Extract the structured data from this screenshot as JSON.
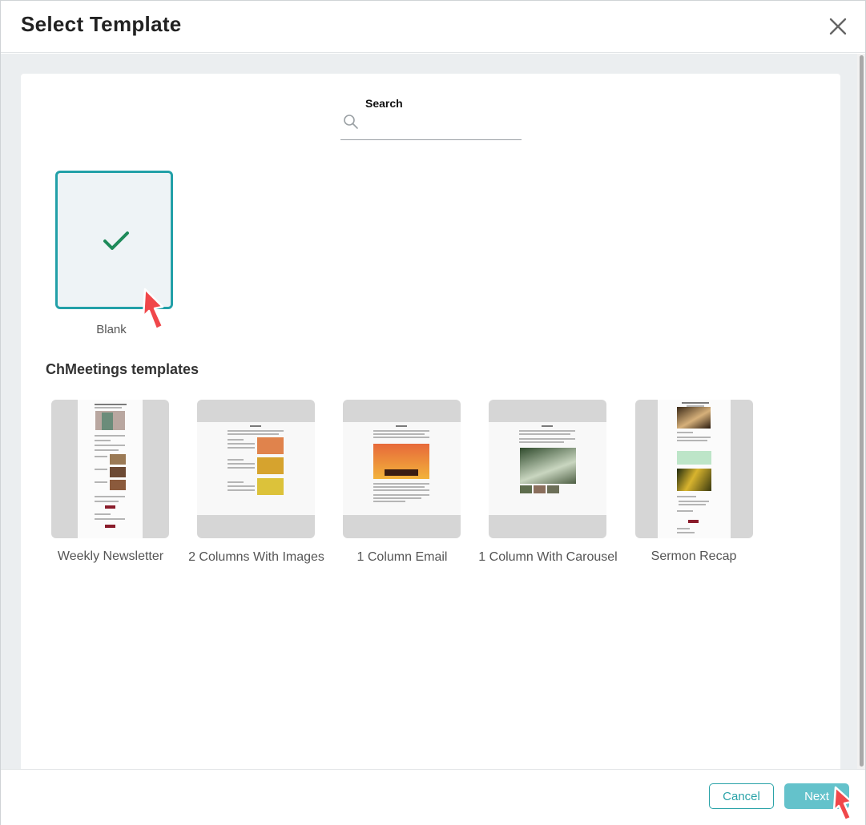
{
  "dialog": {
    "title": "Select Template"
  },
  "search": {
    "label": "Search",
    "value": "",
    "placeholder": ""
  },
  "blank": {
    "label": "Blank",
    "selected": true,
    "accent": "#22a0a8",
    "check_color": "#1e8a5a"
  },
  "section": {
    "title": "ChMeetings templates"
  },
  "templates": [
    {
      "label": "Weekly Newsletter"
    },
    {
      "label": "2 Columns With Images"
    },
    {
      "label": "1 Column Email"
    },
    {
      "label": "1 Column With Carousel"
    },
    {
      "label": "Sermon Recap"
    }
  ],
  "footer": {
    "cancel_label": "Cancel",
    "next_label": "Next"
  },
  "icons": {
    "close": "close-icon",
    "search": "search-icon",
    "check": "check-icon",
    "pointer": "hand-pointer-icon"
  },
  "colors": {
    "teal": "#2aa3a8",
    "next_bg": "#64c2cb",
    "cursor": "#f0474a"
  }
}
